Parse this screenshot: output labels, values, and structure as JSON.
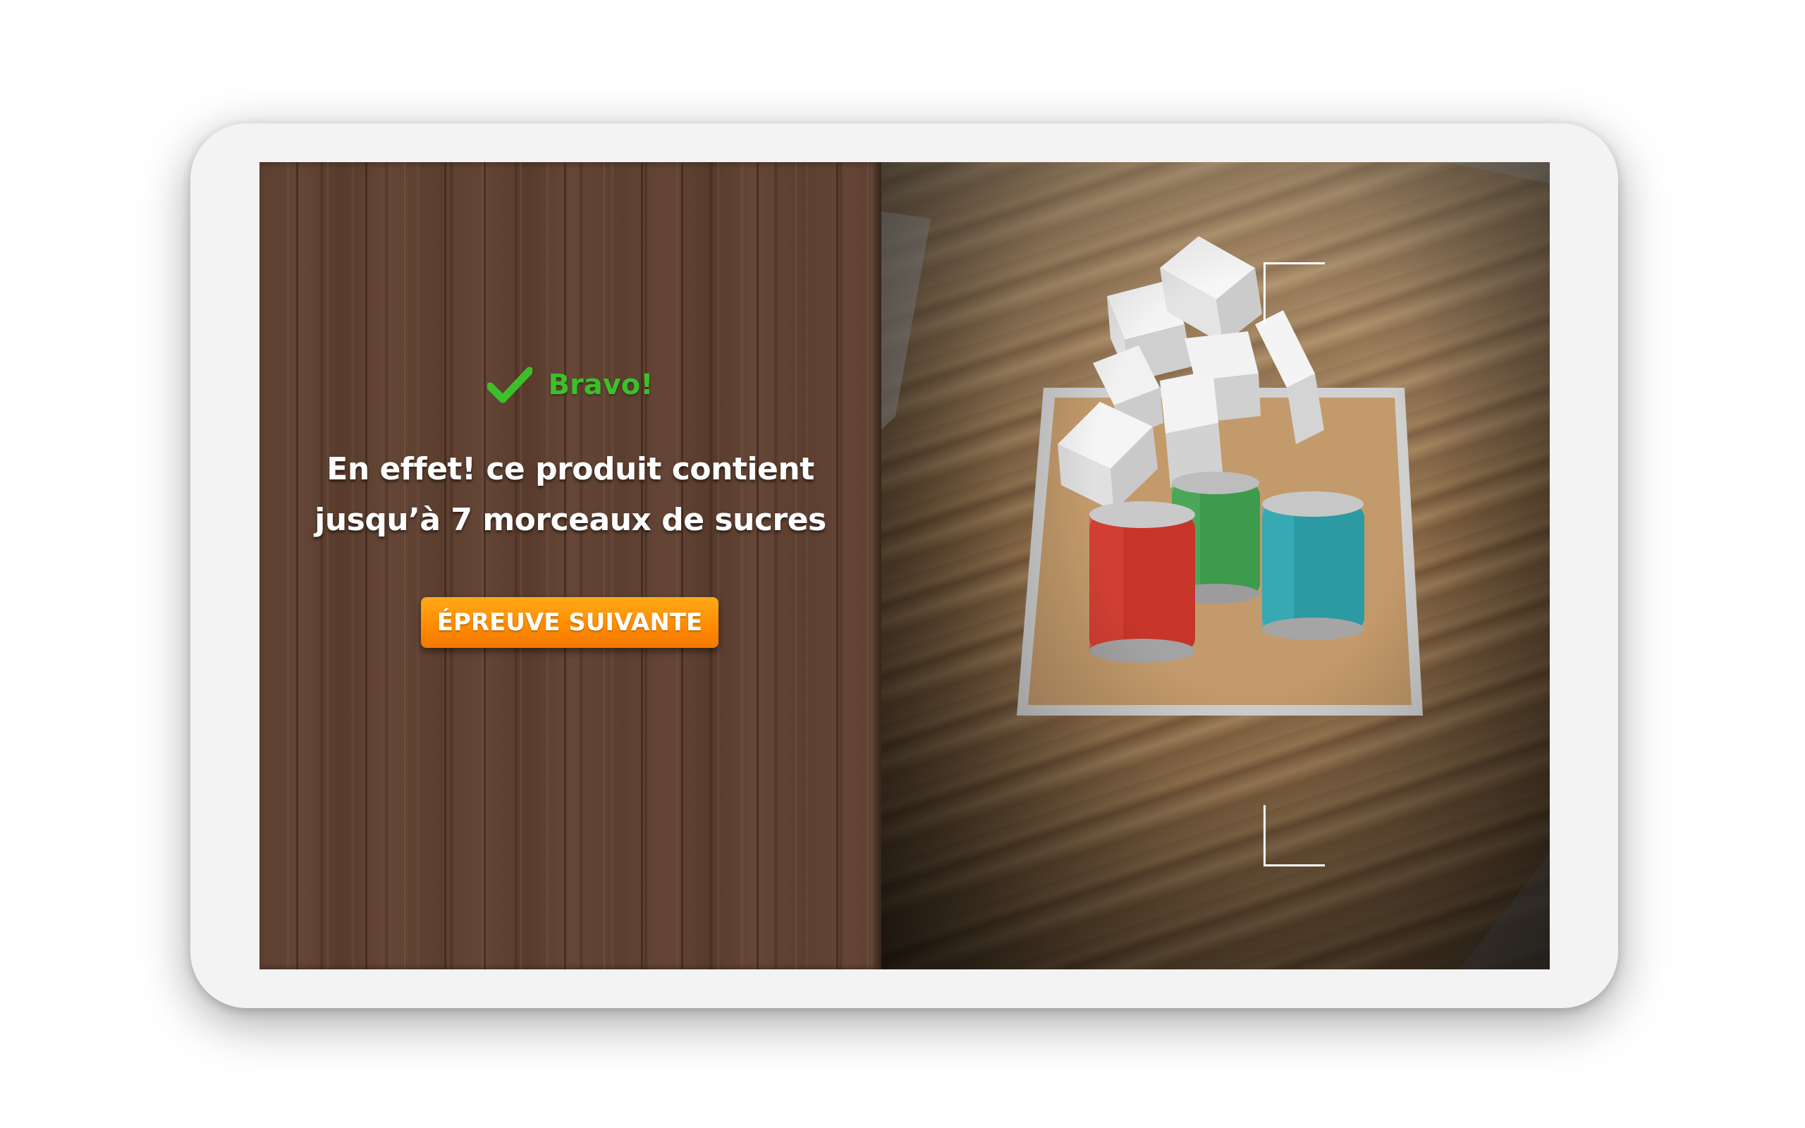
{
  "feedback": {
    "status": "Bravo!",
    "status_icon": "check-icon",
    "status_color": "#3bc02a",
    "message_line1": "En effet! ce produit contient",
    "message_line2": "jusqu’à 7 morceaux de sucres"
  },
  "actions": {
    "next_label": "ÉPREUVE SUIVANTE",
    "next_color": "#ff8a00"
  },
  "scene": {
    "sugar_cubes": 7,
    "cans": [
      "red",
      "green",
      "teal"
    ],
    "can_colors": [
      "#c6342a",
      "#3e9a4d",
      "#2b9aa3"
    ]
  }
}
